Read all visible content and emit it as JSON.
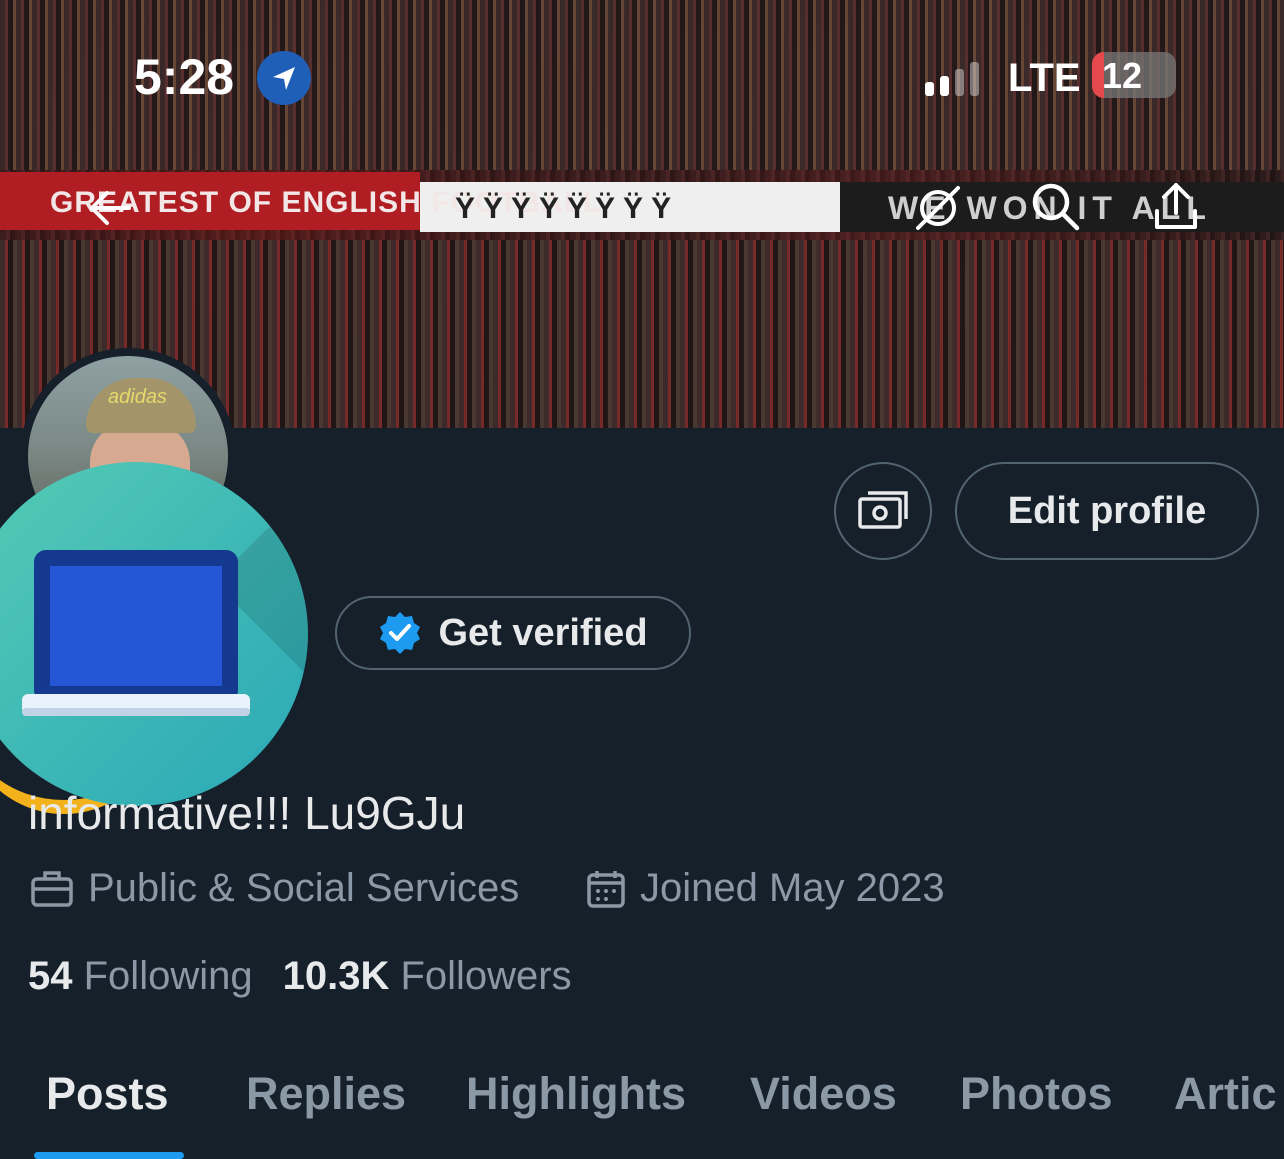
{
  "status_bar": {
    "time": "5:28",
    "network": "LTE",
    "battery_level": "12",
    "battery_percent": 12
  },
  "banner": {
    "red_banner_text": "GREATEST OF ENGLISH FOOTBALL",
    "white_banner_text": "ŸŸŸŸŸŸŸŸ",
    "dark_banner_text": "WE WON IT ALL"
  },
  "actions": {
    "edit_profile": "Edit profile",
    "get_verified": "Get verified"
  },
  "profile": {
    "name_line": "informative!!! Lu9GJu",
    "category": "Public & Social Services",
    "joined": "Joined May 2023",
    "following_count": "54",
    "following_label": "Following",
    "followers_count": "10.3K",
    "followers_label": "Followers"
  },
  "tabs": [
    "Posts",
    "Replies",
    "Highlights",
    "Videos",
    "Photos",
    "Artic"
  ],
  "colors": {
    "accent": "#1d9bf0",
    "background": "#15202b",
    "muted": "#8b98a5"
  }
}
